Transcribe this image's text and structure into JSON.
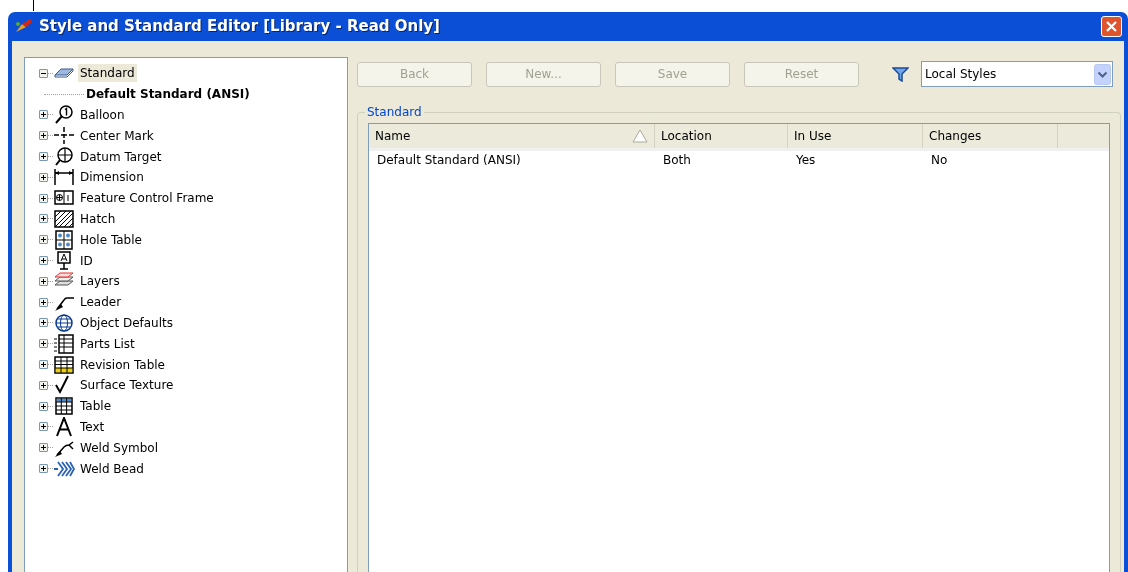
{
  "window": {
    "title": "Style and Standard Editor [Library - Read Only]"
  },
  "tree": [
    {
      "label": "Standard",
      "expanded": true,
      "selected": true,
      "children": [
        {
          "label": "Default Standard (ANSI)",
          "active": true
        }
      ]
    },
    {
      "label": "Balloon",
      "expanded": false,
      "selected": false
    },
    {
      "label": "Center Mark",
      "expanded": false,
      "selected": false
    },
    {
      "label": "Datum Target",
      "expanded": false,
      "selected": false
    },
    {
      "label": "Dimension",
      "expanded": false,
      "selected": false
    },
    {
      "label": "Feature Control Frame",
      "expanded": false,
      "selected": false
    },
    {
      "label": "Hatch",
      "expanded": false,
      "selected": false
    },
    {
      "label": "Hole Table",
      "expanded": false,
      "selected": false
    },
    {
      "label": "ID",
      "expanded": false,
      "selected": false
    },
    {
      "label": "Layers",
      "expanded": false,
      "selected": false
    },
    {
      "label": "Leader",
      "expanded": false,
      "selected": false
    },
    {
      "label": "Object Defaults",
      "expanded": false,
      "selected": false
    },
    {
      "label": "Parts List",
      "expanded": false,
      "selected": false
    },
    {
      "label": "Revision Table",
      "expanded": false,
      "selected": false
    },
    {
      "label": "Surface Texture",
      "expanded": false,
      "selected": false
    },
    {
      "label": "Table",
      "expanded": false,
      "selected": false
    },
    {
      "label": "Text",
      "expanded": false,
      "selected": false
    },
    {
      "label": "Weld Symbol",
      "expanded": false,
      "selected": false
    },
    {
      "label": "Weld Bead",
      "expanded": false,
      "selected": false
    }
  ],
  "toolbar": {
    "buttons": [
      {
        "label": "Back",
        "disabled": true
      },
      {
        "label": "New...",
        "disabled": true
      },
      {
        "label": "Save",
        "disabled": true
      },
      {
        "label": "Reset",
        "disabled": true
      }
    ],
    "filter": {
      "value": "Local Styles"
    }
  },
  "group": {
    "label": "Standard"
  },
  "table": {
    "columns": [
      {
        "label": "Name",
        "sorted": true
      },
      {
        "label": "Location",
        "sorted": false
      },
      {
        "label": "In Use",
        "sorted": false
      },
      {
        "label": "Changes",
        "sorted": false
      }
    ],
    "rows": [
      [
        "Default Standard (ANSI)",
        "Both",
        "Yes",
        "No"
      ]
    ]
  }
}
